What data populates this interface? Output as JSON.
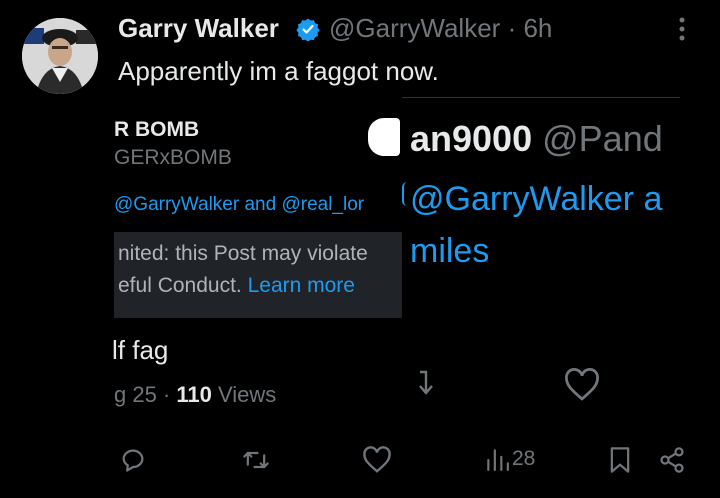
{
  "tweet": {
    "author_name": "Garry Walker",
    "author_handle": "@GarryWalker",
    "time": "· 6h",
    "text": "Apparently im a faggot now."
  },
  "left_screenshot": {
    "name_fragment": "R BOMB",
    "handle_fragment": "GERxBOMB",
    "replying_fragment": "@GarryWalker and @real_lor",
    "notice_line1": "nited: this Post may violate",
    "notice_line2": "eful Conduct.",
    "learn_more": "Learn more",
    "text_fragment": "lf fag",
    "date_fragment": "g 25 ·",
    "views_count": "110",
    "views_label": "Views"
  },
  "right_screenshot": {
    "name_fragment": "an9000",
    "handle_fragment": "@Pand",
    "reply_fragment": "@GarryWalker a",
    "text_fragment": "miles"
  },
  "actions": {
    "views_count": "28"
  },
  "colors": {
    "background": "#000000",
    "text": "#e7e9ea",
    "muted": "#71767b",
    "link": "#1d9bf0",
    "notice_bg": "#202327"
  }
}
